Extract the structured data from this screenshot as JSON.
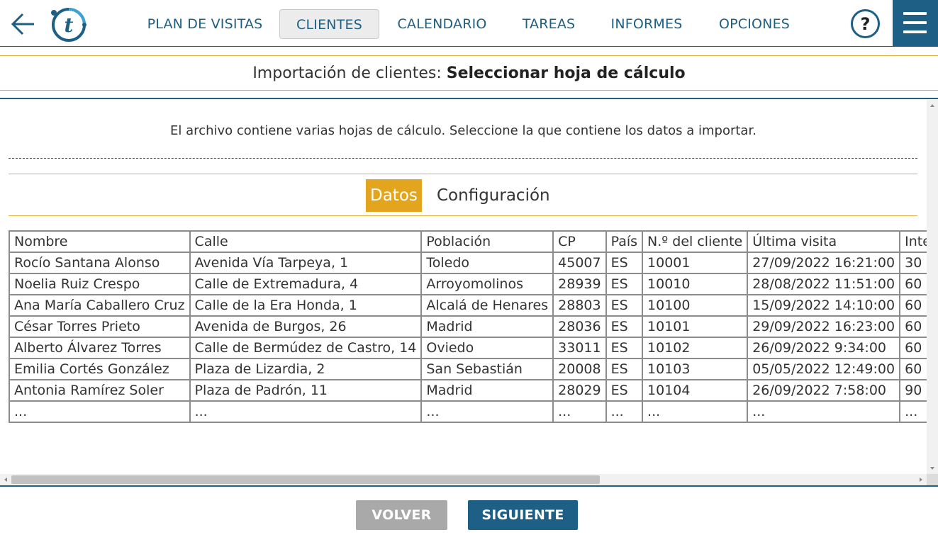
{
  "nav": {
    "items": [
      {
        "label": "PLAN DE VISITAS",
        "active": false
      },
      {
        "label": "CLIENTES",
        "active": true
      },
      {
        "label": "CALENDARIO",
        "active": false
      },
      {
        "label": "TAREAS",
        "active": false
      },
      {
        "label": "INFORMES",
        "active": false
      },
      {
        "label": "OPCIONES",
        "active": false
      }
    ],
    "help_label": "?",
    "logo_letter": "t",
    "icons": {
      "back": "arrow-left-icon",
      "help": "question-icon",
      "menu": "hamburger-icon"
    },
    "colors": {
      "primary": "#1d5f85",
      "accent": "#e3a51e"
    }
  },
  "title": {
    "prefix": "Importación de clientes:",
    "main": "Seleccionar hoja de cálculo"
  },
  "instruction": "El archivo contiene varias hojas de cálculo. Seleccione la que contiene los datos a importar.",
  "tabs": [
    {
      "label": "Datos",
      "active": true
    },
    {
      "label": "Configuración",
      "active": false
    }
  ],
  "sheet": {
    "rows": [
      [
        "Nombre",
        "Calle",
        "Población",
        "CP",
        "País",
        "N.º del cliente",
        "Última visita",
        "Intervalo"
      ],
      [
        "Rocío Santana Alonso",
        "Avenida Vía Tarpeya, 1",
        "Toledo",
        "45007",
        "ES",
        "10001",
        "27/09/2022 16:21:00",
        "30"
      ],
      [
        "Noelia Ruiz Crespo",
        "Calle de Extremadura, 4",
        "Arroyomolinos",
        "28939",
        "ES",
        "10010",
        "28/08/2022 11:51:00",
        "60"
      ],
      [
        "Ana María Caballero Cruz",
        "Calle de la Era Honda, 1",
        "Alcalá de Henares",
        "28803",
        "ES",
        "10100",
        "15/09/2022 14:10:00",
        "60"
      ],
      [
        "César Torres Prieto",
        "Avenida de Burgos, 26",
        "Madrid",
        "28036",
        "ES",
        "10101",
        "29/09/2022 16:23:00",
        "60"
      ],
      [
        "Alberto Álvarez Torres",
        "Calle de Bermúdez de Castro, 14",
        "Oviedo",
        "33011",
        "ES",
        "10102",
        "26/09/2022 9:34:00",
        "60"
      ],
      [
        "Emilia Cortés González",
        "Plaza de Lizardia, 2",
        "San Sebastián",
        "20008",
        "ES",
        "10103",
        "05/05/2022 12:49:00",
        "60"
      ],
      [
        "Antonia Ramírez Soler",
        "Plaza de Padrón, 11",
        "Madrid",
        "28029",
        "ES",
        "10104",
        "26/09/2022 7:58:00",
        "90"
      ],
      [
        "...",
        "...",
        "...",
        "...",
        "...",
        "...",
        "...",
        "..."
      ]
    ]
  },
  "footer": {
    "back_label": "VOLVER",
    "next_label": "SIGUIENTE"
  }
}
